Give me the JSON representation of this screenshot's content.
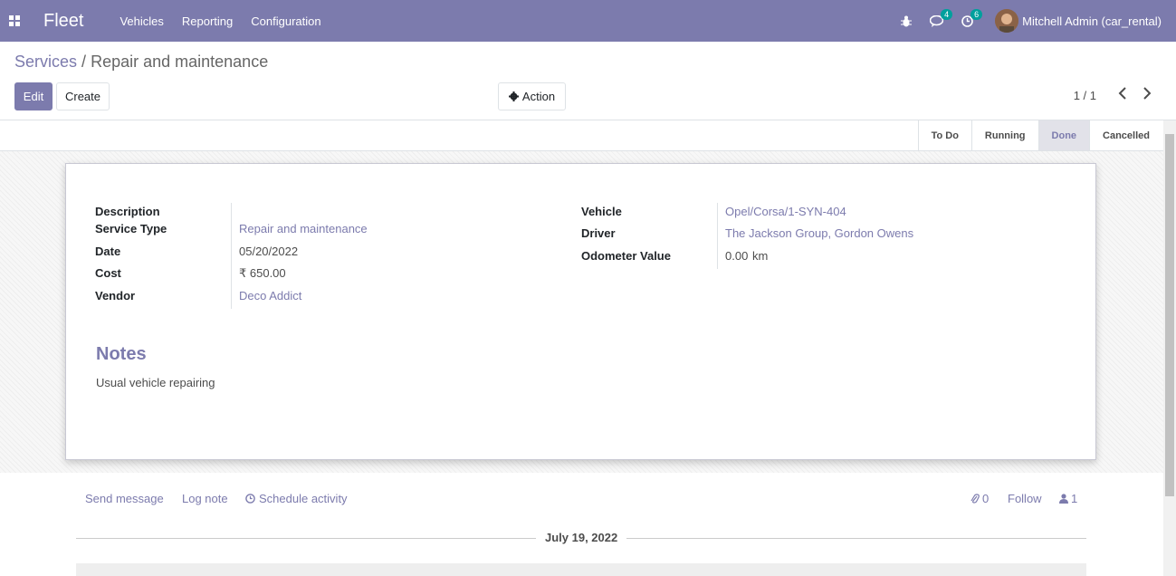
{
  "app": {
    "title": "Fleet"
  },
  "menu": [
    "Vehicles",
    "Reporting",
    "Configuration"
  ],
  "systray": {
    "messages_count": "4",
    "activities_count": "6",
    "user": "Mitchell Admin (car_rental)"
  },
  "breadcrumb": {
    "parent": "Services",
    "separator": "/",
    "current": "Repair and maintenance"
  },
  "buttons": {
    "edit": "Edit",
    "create": "Create",
    "action": "Action"
  },
  "pager": "1 / 1",
  "stages": [
    "To Do",
    "Running",
    "Done",
    "Cancelled"
  ],
  "active_stage": "Done",
  "form": {
    "left": [
      {
        "label": "Description",
        "value": ""
      },
      {
        "label": "Service Type",
        "value": "Repair and maintenance"
      },
      {
        "label": "Date",
        "value": "05/20/2022"
      },
      {
        "label": "Cost",
        "value": "₹ 650.00"
      },
      {
        "label": "Vendor",
        "value": "Deco Addict"
      }
    ],
    "right": [
      {
        "label": "Vehicle",
        "value": "Opel/Corsa/1-SYN-404"
      },
      {
        "label": "Driver",
        "value": "The Jackson Group, Gordon Owens"
      },
      {
        "label": "Odometer Value",
        "value": "0.00",
        "unit": "km"
      }
    ]
  },
  "notes": {
    "title": "Notes",
    "text": "Usual vehicle repairing"
  },
  "chatter": {
    "send_message": "Send message",
    "log_note": "Log note",
    "schedule_activity": "Schedule activity",
    "attachments": "0",
    "follow": "Follow",
    "followers": "1",
    "date": "July 19, 2022"
  },
  "colors": {
    "primary": "#7c7bad",
    "teal_badge": "#00a09d"
  }
}
